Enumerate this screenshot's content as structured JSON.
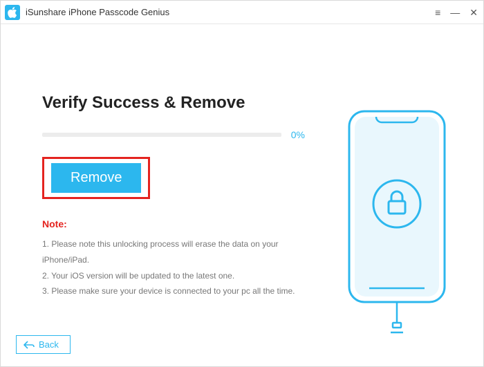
{
  "app": {
    "title": "iSunshare iPhone Passcode Genius"
  },
  "main": {
    "heading": "Verify Success & Remove",
    "progress_percent": "0%",
    "remove_label": "Remove",
    "note_heading": "Note:",
    "notes": [
      "1. Please note this unlocking process will erase the data on your iPhone/iPad.",
      "2. Your iOS version will be updated to the latest one.",
      "3. Please make sure your device is connected to your pc all the time."
    ]
  },
  "footer": {
    "back_label": "Back"
  },
  "colors": {
    "accent": "#2cb7ee",
    "danger": "#e4231f"
  }
}
